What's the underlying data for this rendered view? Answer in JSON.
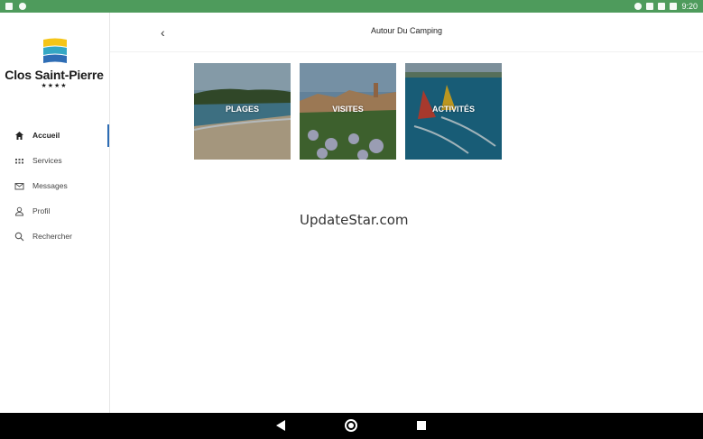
{
  "status_bar": {
    "time": "9:20"
  },
  "sidebar": {
    "brand": "Clos Saint-Pierre",
    "stars": "★★★★",
    "items": [
      {
        "label": "Accueil",
        "icon": "home-icon",
        "active": true
      },
      {
        "label": "Services",
        "icon": "grid-icon",
        "active": false
      },
      {
        "label": "Messages",
        "icon": "mail-icon",
        "active": false
      },
      {
        "label": "Profil",
        "icon": "person-icon",
        "active": false
      },
      {
        "label": "Rechercher",
        "icon": "search-icon",
        "active": false
      }
    ]
  },
  "header": {
    "back_icon": "chevron-left-icon",
    "title": "Autour Du Camping"
  },
  "tiles": [
    {
      "label": "PLAGES"
    },
    {
      "label": "VISITES"
    },
    {
      "label": "ACTIVITÉS"
    }
  ],
  "watermark": "UpdateStar.com",
  "colors": {
    "status_bar": "#4e9b5c",
    "accent": "#2d6cb4"
  }
}
